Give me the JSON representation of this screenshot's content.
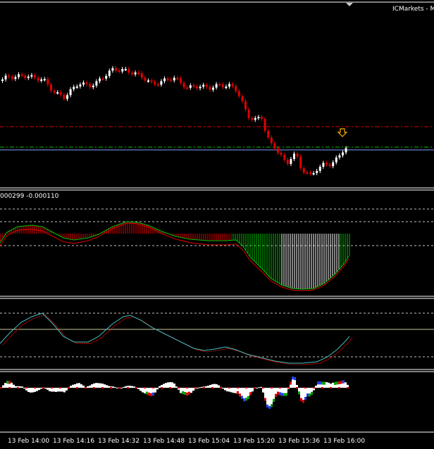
{
  "window": {
    "broker_label": "ICMarkets - M",
    "arrow_marker_icon": "down-arrow-icon"
  },
  "indicator_1": {
    "values_label": "000299 -0.000110"
  },
  "colors": {
    "background": "#000000",
    "bull_candle": "#ffffff",
    "bear_candle": "#e00000",
    "red_level": "#e00000",
    "green_level": "#00c000",
    "blue_level": "#7f9fff",
    "osc_green": "#00c000",
    "osc_red": "#e00000",
    "signal_cyan": "#3fbfbf",
    "hist_blue": "#2040ff",
    "hist_green": "#00a000",
    "marker": "#ffb000"
  },
  "time_axis": {
    "labels": [
      "13 Feb 14:00",
      "13 Feb 14:16",
      "13 Feb 14:32",
      "13 Feb 14:48",
      "13 Feb 15:04",
      "13 Feb 15:20",
      "13 Feb 15:36",
      "13 Feb 16:00"
    ]
  }
}
